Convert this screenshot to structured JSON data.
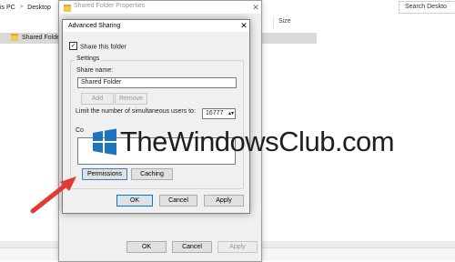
{
  "explorer": {
    "breadcrumb_part1": "is PC",
    "breadcrumb_sep": ">",
    "breadcrumb_part2": "Desktop",
    "search_placeholder": "Search Deskto",
    "column_size": "Size",
    "folder_name": "Shared Folder"
  },
  "properties_window": {
    "title": "Shared Folder Properties",
    "close_glyph": "✕",
    "ok_label": "OK",
    "cancel_label": "Cancel",
    "apply_label": "Apply"
  },
  "advanced_sharing": {
    "title": "Advanced Sharing",
    "close_glyph": "✕",
    "share_checkbox_label": "Share this folder",
    "share_checked": true,
    "settings_legend": "Settings",
    "share_name_label": "Share name:",
    "share_name_value": "Shared Folder",
    "add_label": "Add",
    "remove_label": "Remove",
    "limit_label": "Limit the number of simultaneous users to:",
    "limit_value": "16777",
    "comments_label": "Co",
    "permissions_label": "Permissions",
    "caching_label": "Caching",
    "ok_label": "OK",
    "cancel_label": "Cancel",
    "apply_label": "Apply"
  },
  "watermark": {
    "text": "TheWindowsClub.com",
    "logo_color": "#1e73be"
  },
  "icons": {
    "folder": "folder-icon",
    "arrow": "red-arrow-icon",
    "checkmark": "✓"
  },
  "colors": {
    "arrow": "#e53935",
    "selection": "#d9d9d9",
    "accent_border": "#0078d7"
  }
}
